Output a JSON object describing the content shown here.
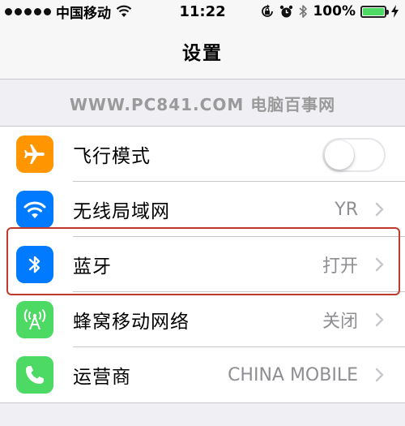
{
  "status_bar": {
    "carrier": "中国移动",
    "time": "11:22",
    "battery": "100%",
    "icons": [
      "signal-dots-icon",
      "wifi-icon",
      "rotation-lock-icon",
      "alarm-icon",
      "bluetooth-icon",
      "battery-charging-icon"
    ]
  },
  "nav": {
    "title": "设置"
  },
  "watermark": "WWW.PC841.COM 电脑百事网",
  "settings": [
    {
      "id": "airplane",
      "label": "飞行模式",
      "icon": "airplane-icon",
      "color": "#ff9500",
      "toggle": false
    },
    {
      "id": "wifi",
      "label": "无线局域网",
      "value": "YR",
      "icon": "wifi-icon",
      "color": "#007aff"
    },
    {
      "id": "bluetooth",
      "label": "蓝牙",
      "value": "打开",
      "icon": "bluetooth-icon",
      "color": "#007aff",
      "highlighted": true
    },
    {
      "id": "cellular",
      "label": "蜂窝移动网络",
      "value": "关闭",
      "icon": "cellular-antenna-icon",
      "color": "#4cd964"
    },
    {
      "id": "carrier",
      "label": "运营商",
      "value": "CHINA MOBILE",
      "icon": "phone-icon",
      "color": "#4cd964"
    }
  ],
  "highlight_color": "#c0392b"
}
